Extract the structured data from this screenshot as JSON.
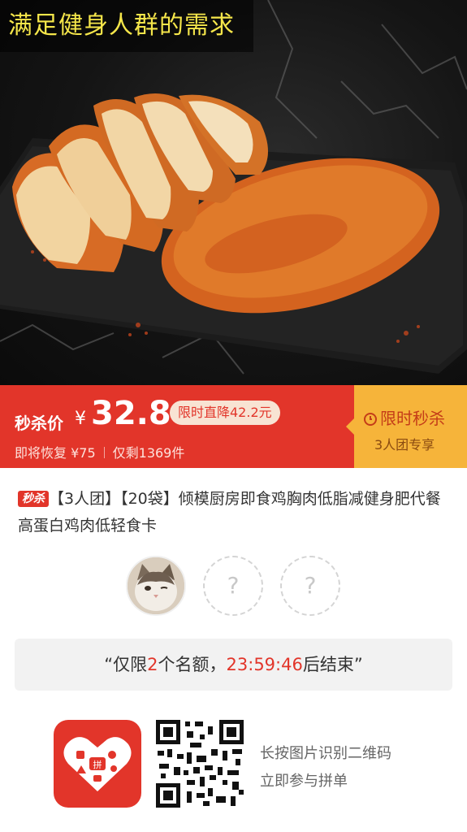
{
  "hero": {
    "caption": "满足健身人群的需求"
  },
  "price_band": {
    "price_label": "秒杀价",
    "currency_symbol": "¥",
    "price": "32.8",
    "discount": "限时直降42.2元",
    "restore_price": "即将恢复 ¥75",
    "remaining": "仅剩1369件",
    "flash_title": "限时秒杀",
    "flash_sub": "3人团专享"
  },
  "product": {
    "tag": "秒杀",
    "title": "【3人团】【20袋】倾模厨房即食鸡胸肉低脂减健身肥代餐高蛋白鸡肉低轻食卡"
  },
  "group": {
    "empty_slot_1": "?",
    "empty_slot_2": "?"
  },
  "notice": {
    "prefix": "“仅限",
    "count": "2",
    "middle": "个名额，",
    "countdown": "23:59:46",
    "suffix": "后结束”"
  },
  "footer": {
    "line1": "长按图片识别二维码",
    "line2": "立即参与拼单"
  },
  "colors": {
    "accent": "#e2352a",
    "flash_bg": "#f6b43a",
    "caption_text": "#f5e64a"
  }
}
